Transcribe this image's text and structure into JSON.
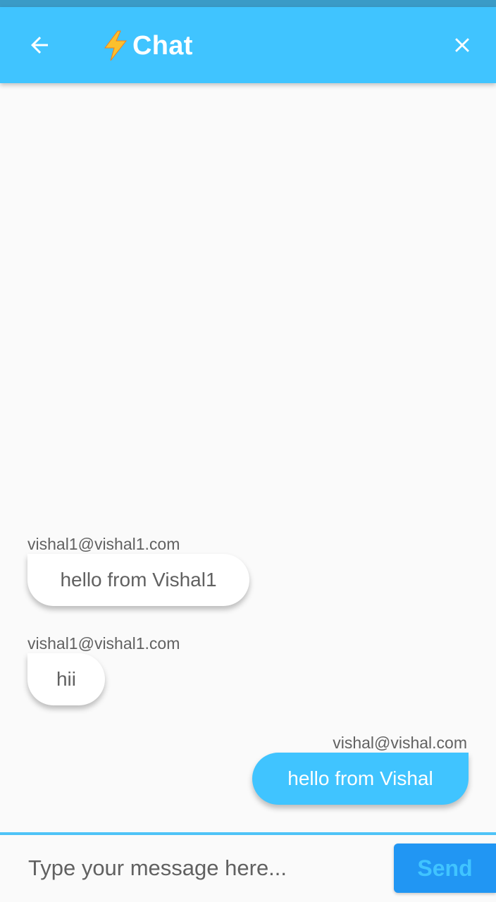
{
  "app_bar": {
    "title": "Chat",
    "back_icon": "arrow-left-icon",
    "close_icon": "close-icon",
    "title_icon": "lightning-bolt-icon",
    "color": "#40c4ff"
  },
  "messages": [
    {
      "sender": "vishal1@vishal1.com",
      "text": "hello from Vishal1",
      "direction": "incoming"
    },
    {
      "sender": "vishal1@vishal1.com",
      "text": "hii",
      "direction": "incoming"
    },
    {
      "sender": "vishal@vishal.com",
      "text": "hello from Vishal",
      "direction": "outgoing"
    }
  ],
  "composer": {
    "placeholder": "Type your message here...",
    "value": "",
    "send_label": "Send",
    "border_color": "#4fc3f7",
    "send_bg": "#2196f3"
  }
}
